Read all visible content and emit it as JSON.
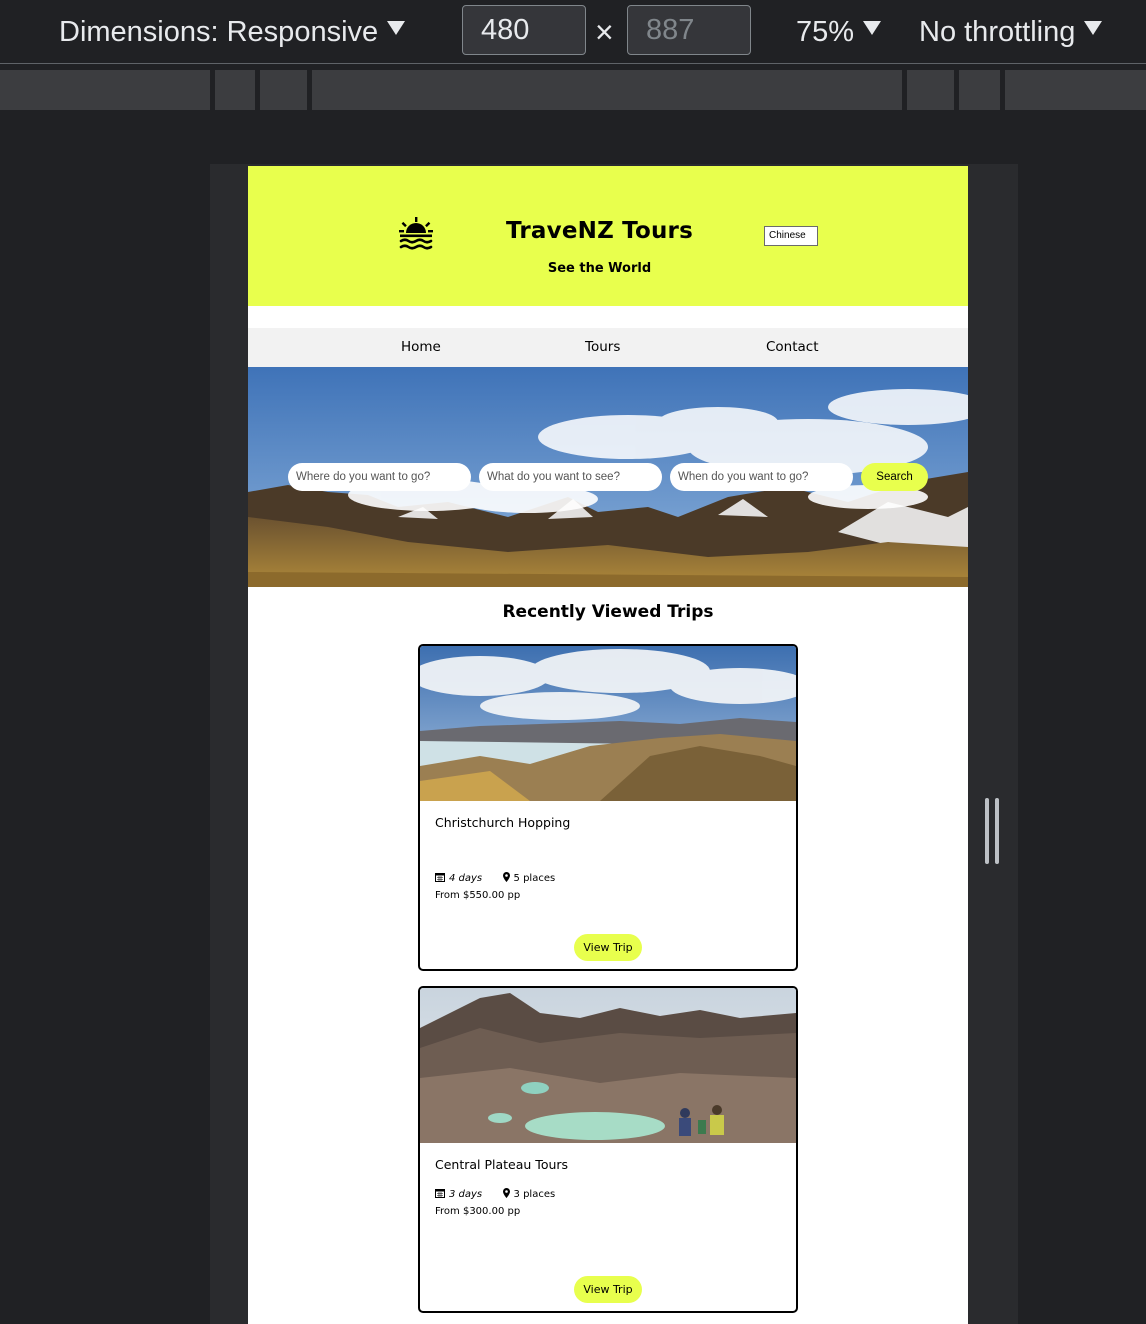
{
  "devtools": {
    "dimensions_label": "Dimensions: Responsive",
    "width_value": "480",
    "height_placeholder": "887",
    "times_symbol": "×",
    "zoom_label": "75%",
    "throttling_label": "No throttling"
  },
  "site": {
    "brand_color": "#e8ff4d",
    "title": "TraveNZ Tours",
    "tagline": "See the World",
    "language_select": "Chinese"
  },
  "nav": {
    "items": [
      {
        "label": "Home"
      },
      {
        "label": "Tours"
      },
      {
        "label": "Contact"
      }
    ]
  },
  "search": {
    "where_placeholder": "Where do you want to go?",
    "what_placeholder": "What do you want to see?",
    "when_placeholder": "When do you want to go?",
    "button_label": "Search"
  },
  "recent": {
    "title": "Recently Viewed Trips",
    "cards": [
      {
        "title": "Christchurch Hopping",
        "days": "4 days",
        "places": "5 places",
        "price": "From $550.00 pp",
        "button": "View Trip",
        "image_icon": "lake-mountain-photo"
      },
      {
        "title": "Central Plateau Tours",
        "days": "3 days",
        "places": "3 places",
        "price": "From $300.00 pp",
        "button": "View Trip",
        "image_icon": "emerald-lakes-photo"
      }
    ]
  }
}
